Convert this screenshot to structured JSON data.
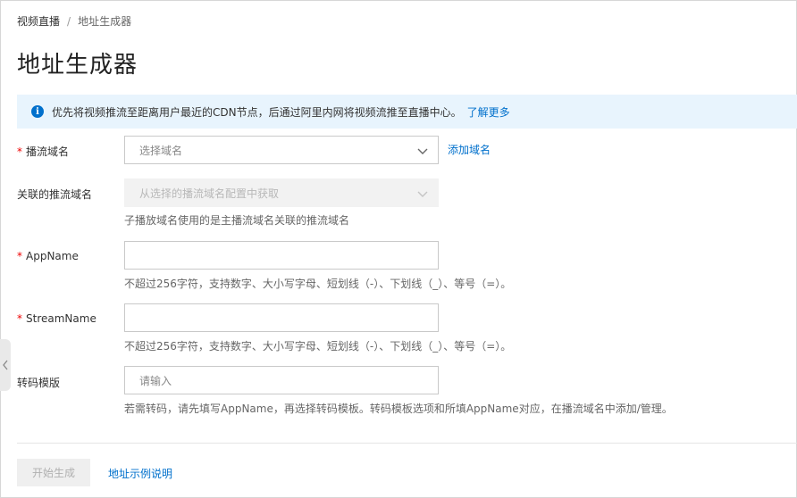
{
  "breadcrumb": {
    "parent": "视频直播",
    "separator": "/",
    "current": "地址生成器"
  },
  "page_title": "地址生成器",
  "notice": {
    "text": "优先将视频推流至距离用户最近的CDN节点，后通过阿里内网将视频流推至直播中心。",
    "link": "了解更多"
  },
  "form": {
    "push_domain": {
      "label": "播流域名",
      "placeholder": "选择域名",
      "add_link": "添加域名"
    },
    "related_push_domain": {
      "label": "关联的推流域名",
      "placeholder": "从选择的播流域名配置中获取",
      "help": "子播放域名使用的是主播流域名关联的推流域名"
    },
    "app_name": {
      "label": "AppName",
      "value": "",
      "help": "不超过256字符，支持数字、大小写字母、短划线（-）、下划线（_）、等号（=）。"
    },
    "stream_name": {
      "label": "StreamName",
      "value": "",
      "help": "不超过256字符，支持数字、大小写字母、短划线（-）、下划线（_）、等号（=）。"
    },
    "transcode_template": {
      "label": "转码模版",
      "placeholder": "请输入",
      "help": "若需转码，请先填写AppName，再选择转码模板。转码模板选项和所填AppName对应，在播流域名中添加/管理。"
    }
  },
  "footer": {
    "generate_button": "开始生成",
    "example_link": "地址示例说明"
  },
  "colors": {
    "link": "#0070cc",
    "required": "#e00000",
    "notice_bg": "#e8f4fd"
  }
}
